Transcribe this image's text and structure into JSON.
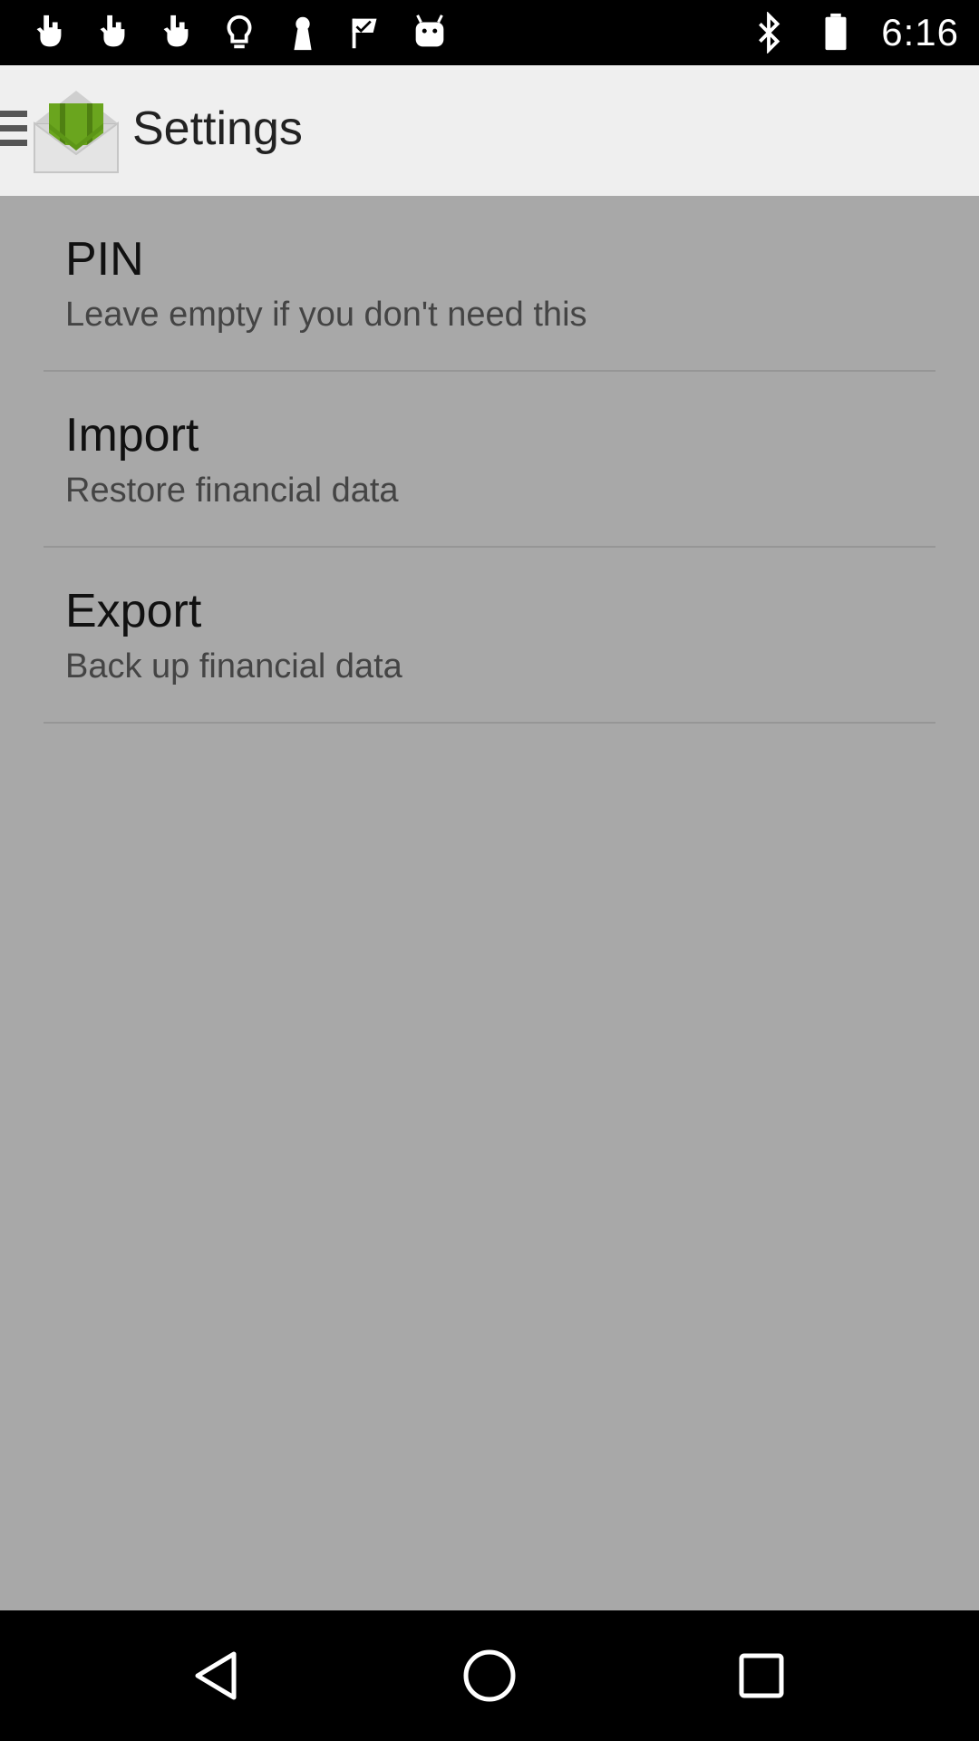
{
  "status_bar": {
    "time": "6:16",
    "left_icons": [
      "hand-point-icon",
      "hand-point-icon",
      "hand-point-icon",
      "lightbulb-icon",
      "keyhole-icon",
      "check-flag-icon",
      "android-icon"
    ],
    "right_icons": [
      "bluetooth-icon",
      "battery-icon"
    ]
  },
  "app_bar": {
    "title": "Settings",
    "icons": [
      "menu-icon",
      "app-logo-envelope-icon"
    ]
  },
  "preferences": [
    {
      "title": "PIN",
      "summary": "Leave empty if you don't need this"
    },
    {
      "title": "Import",
      "summary": "Restore financial data"
    },
    {
      "title": "Export",
      "summary": "Back up financial data"
    }
  ],
  "nav_bar": {
    "buttons": [
      "back-icon",
      "home-icon",
      "recents-icon"
    ]
  },
  "colors": {
    "content_bg": "#a8a8a8",
    "app_bar_bg": "#efefef",
    "logo_green": "#6aa51e",
    "system_bars": "#000000"
  }
}
